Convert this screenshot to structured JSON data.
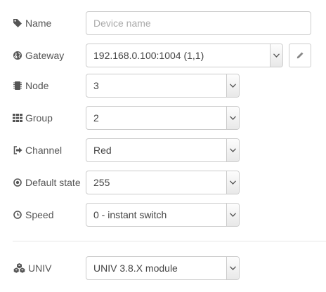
{
  "fields": {
    "name": {
      "label": "Name",
      "placeholder": "Device name",
      "value": "",
      "icon": "tag-icon"
    },
    "gateway": {
      "label": "Gateway",
      "value": "192.168.0.100:1004 (1,1)",
      "icon": "globe-icon",
      "edit_icon": "pencil-icon"
    },
    "node": {
      "label": "Node",
      "value": "3",
      "icon": "chip-icon"
    },
    "group": {
      "label": "Group",
      "value": "2",
      "icon": "grid-icon"
    },
    "channel": {
      "label": "Channel",
      "value": "Red",
      "icon": "sign-out-icon"
    },
    "default_state": {
      "label": "Default state",
      "value": "255",
      "icon": "dot-circle-icon"
    },
    "speed": {
      "label": "Speed",
      "value": "0 - instant switch",
      "icon": "clock-icon"
    },
    "univ": {
      "label": "UNIV",
      "value": "UNIV 3.8.X module",
      "icon": "cubes-icon"
    }
  },
  "colors": {
    "text": "#555555",
    "border": "#cccccc",
    "placeholder": "#aaaaaa"
  }
}
